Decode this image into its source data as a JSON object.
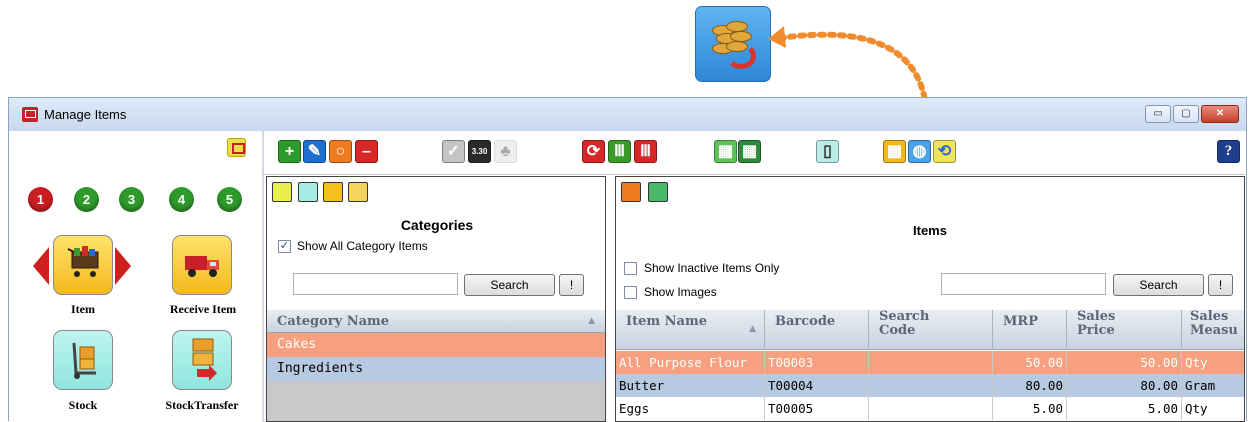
{
  "window": {
    "title": "Manage Items"
  },
  "window_buttons": {
    "minimize": "▭",
    "maximize": "▢",
    "close": "✕"
  },
  "left_panel": {
    "steps": [
      "1",
      "2",
      "3",
      "4",
      "5"
    ],
    "tiles": [
      {
        "label": "Item",
        "icon": "shopping-cart-icon"
      },
      {
        "label": "Receive Item",
        "icon": "truck-icon"
      },
      {
        "label": "Stock",
        "icon": "hand-truck-icon"
      },
      {
        "label": "StockTransfer",
        "icon": "transfer-boxes-icon"
      }
    ]
  },
  "toolbar": {
    "buttons": [
      "add-icon",
      "edit-icon",
      "search-icon",
      "delete-icon",
      "check-icon",
      "calculator-icon",
      "hierarchy-icon",
      "refresh-icon",
      "chart-green-icon",
      "chart-red-icon",
      "table-add-icon",
      "table-remove-icon",
      "stock-icon",
      "color-chart-icon",
      "coins-refresh-icon",
      "reload-icon"
    ],
    "help_label": "?"
  },
  "categories": {
    "title": "Categories",
    "show_all_label": "Show All Category Items",
    "show_all_checked": true,
    "search_value": "",
    "search_button": "Search",
    "clear_button": "!",
    "column_header": "Category Name",
    "rows": [
      "Cakes",
      "Ingredients"
    ]
  },
  "items": {
    "title": "Items",
    "inactive_label": "Show Inactive Items Only",
    "images_label": "Show Images",
    "search_value": "",
    "search_button": "Search",
    "clear_button": "!",
    "columns": [
      "Item Name",
      "Barcode",
      "Search Code",
      "MRP",
      "Sales Price",
      "Sales Measu"
    ],
    "rows": [
      {
        "name": "All Purpose Flour",
        "barcode": "T00003",
        "search_code": "",
        "mrp": "50.00",
        "sales_price": "50.00",
        "measure": "Qty"
      },
      {
        "name": "Butter",
        "barcode": "T00004",
        "search_code": "",
        "mrp": "80.00",
        "sales_price": "80.00",
        "measure": "Gram"
      },
      {
        "name": "Eggs",
        "barcode": "T00005",
        "search_code": "",
        "mrp": "5.00",
        "sales_price": "5.00",
        "measure": "Qty"
      }
    ]
  },
  "colors": {
    "selected_row": "#f7a07f",
    "alt_row": "#b8c9e2",
    "accent": "#f08c2e"
  }
}
